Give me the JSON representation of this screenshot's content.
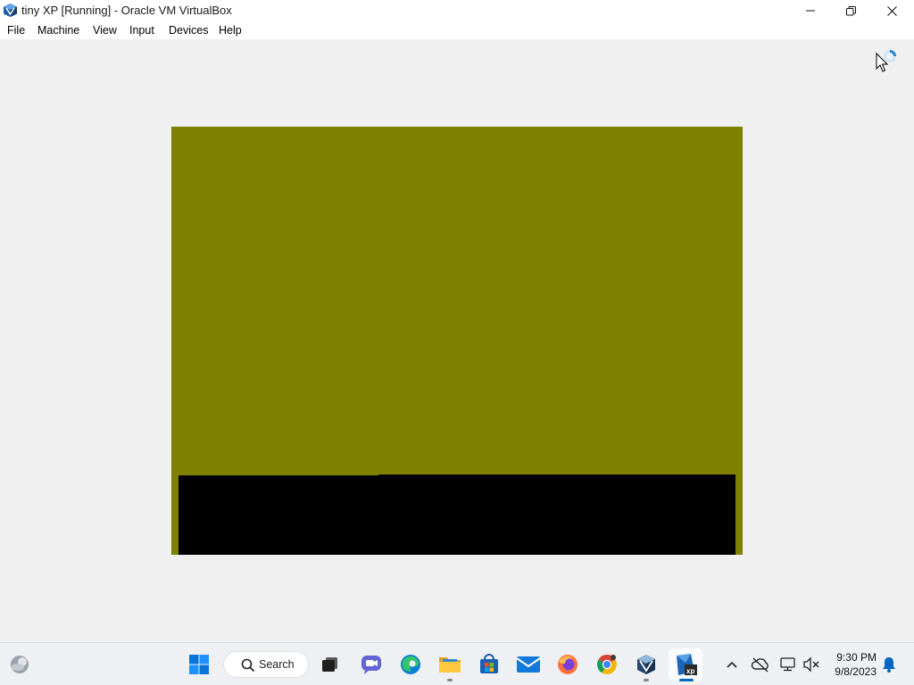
{
  "window": {
    "title": "tiny XP [Running] - Oracle VM VirtualBox",
    "app_icon": "virtualbox-icon"
  },
  "window_controls": [
    "minimize-icon",
    "restore-icon",
    "close-icon"
  ],
  "menu": {
    "items": [
      "File",
      "Machine",
      "View",
      "Input",
      "Devices",
      "Help"
    ]
  },
  "vm": {
    "screen_color": "#808000",
    "bar_color": "#000000",
    "cursor": "busy-pointer-icon"
  },
  "taskbar": {
    "search_label": "Search",
    "pinned": [
      "windows-start-icon",
      "task-view-icon",
      "teams-chat-icon",
      "edge-icon",
      "file-explorer-icon",
      "microsoft-store-icon",
      "mail-icon",
      "firefox-icon",
      "chrome-icon",
      "virtualbox-icon",
      "tiny-xp-vm-icon"
    ],
    "tray": [
      "chevron-up-icon",
      "onedrive-icon",
      "network-icon",
      "volume-muted-icon"
    ],
    "time": "9:30 PM",
    "date": "9/8/2023",
    "accent": "#0067c0"
  }
}
